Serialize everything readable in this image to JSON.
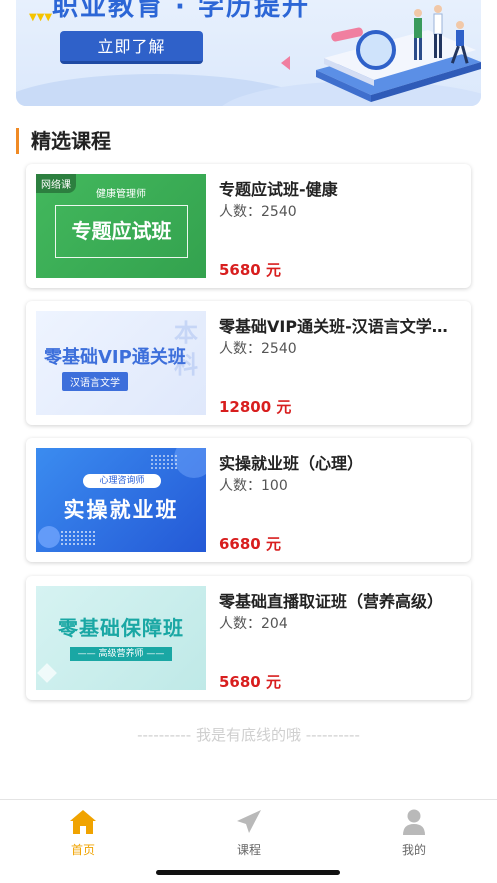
{
  "banner": {
    "title": "职业教育 · 学历提升",
    "button_label": "立即了解",
    "arrows": "▼▼▼"
  },
  "section": {
    "title": "精选课程"
  },
  "courses": [
    {
      "title": "专题应试班-健康",
      "count": "人数：2540",
      "price": "5680 元",
      "thumb": {
        "tag": "网络课",
        "subtitle": "健康管理师",
        "main": "专题应试班"
      }
    },
    {
      "title": "零基础VIP通关班-汉语言文学…",
      "count": "人数：2540",
      "price": "12800 元",
      "thumb": {
        "main": "零基础VIP通关班",
        "ribbon": "汉语言文学",
        "watermark": "本科"
      }
    },
    {
      "title": "实操就业班（心理）",
      "count": "人数：100",
      "price": "6680 元",
      "thumb": {
        "pill": "心理咨询师",
        "main": "实操就业班"
      }
    },
    {
      "title": "零基础直播取证班（营养高级）",
      "count": "人数：204",
      "price": "5680 元",
      "thumb": {
        "main": "零基础保障班",
        "ribbon": "—— 高级营养师 ——"
      }
    }
  ],
  "bottom_note": "---------- 我是有底线的哦 ----------",
  "tabbar": {
    "items": [
      {
        "label": "首页",
        "icon": "home-icon",
        "active": true
      },
      {
        "label": "课程",
        "icon": "paper-plane-icon",
        "active": false
      },
      {
        "label": "我的",
        "icon": "user-icon",
        "active": false
      }
    ]
  },
  "colors": {
    "accent": "#f0a300",
    "price": "#d81e1e",
    "section_bar": "#f08a24",
    "banner_button": "#2f61c9"
  }
}
